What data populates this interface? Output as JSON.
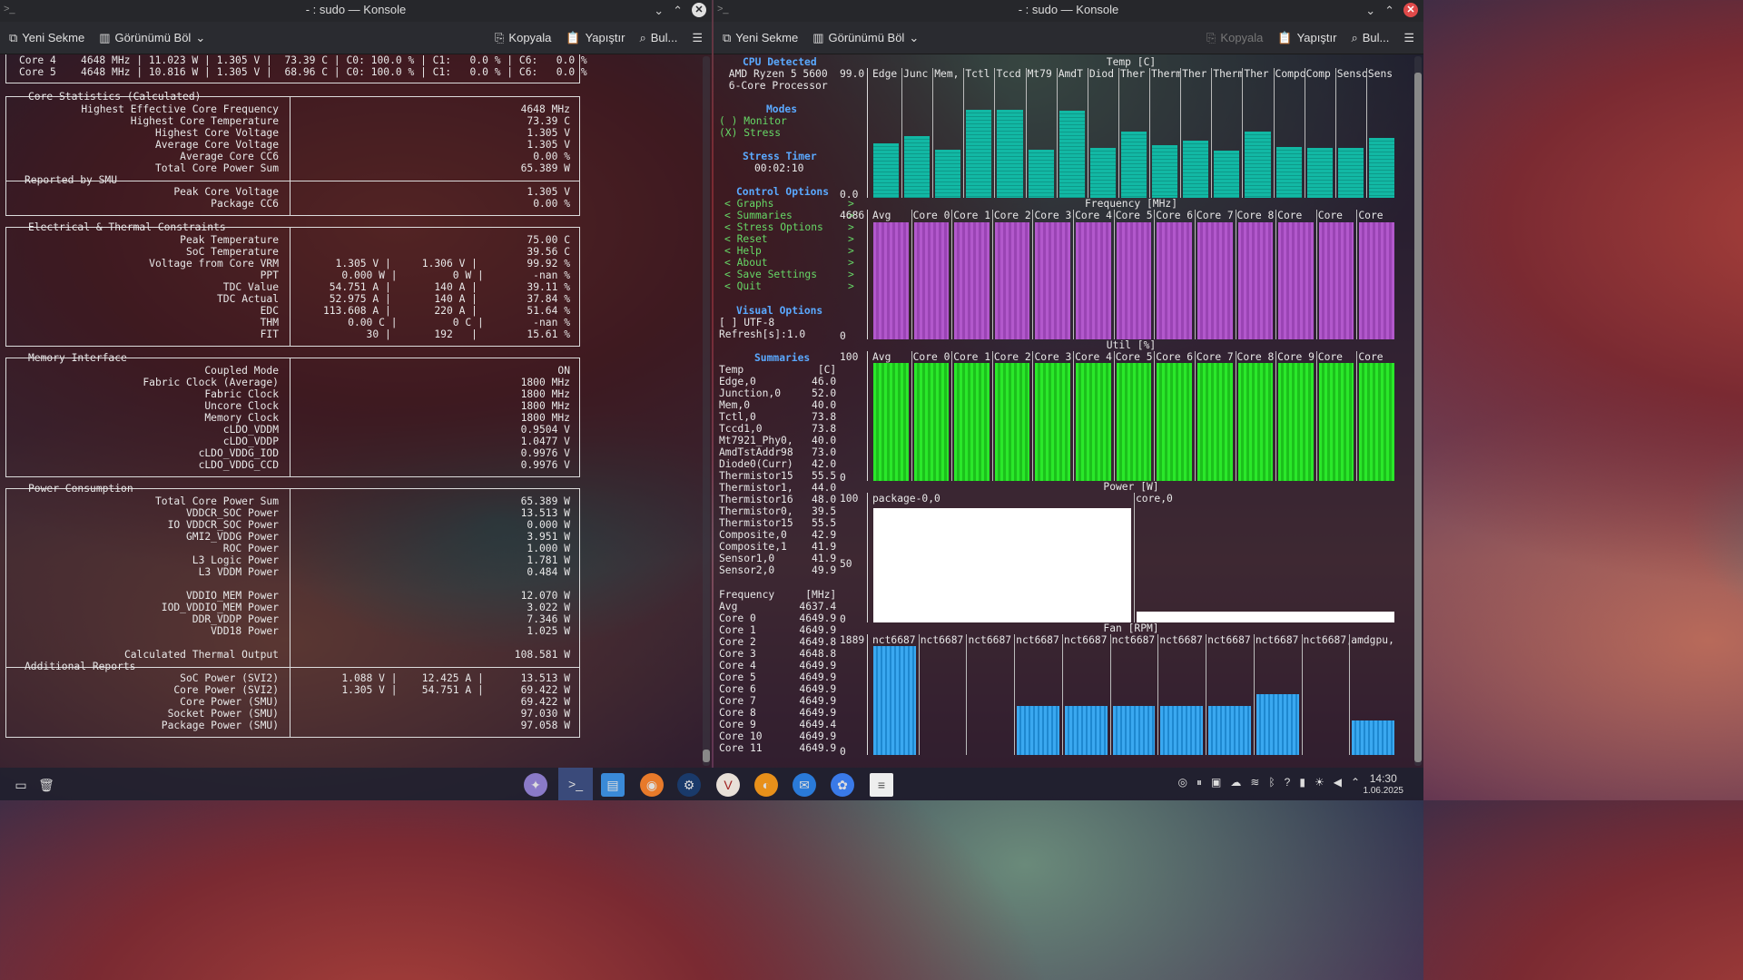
{
  "window_left": {
    "title": "- : sudo — Konsole",
    "toolbar": {
      "new_tab": "Yeni Sekme",
      "split": "Görünümü Böl",
      "copy": "Kopyala",
      "paste": "Yapıştır",
      "find": "Bul..."
    },
    "top_rows": [
      "Core 4    4648 MHz | 11.023 W | 1.305 V |  73.39 C | C0: 100.0 % | C1:   0.0 % | C6:   0.0 %",
      "Core 5    4648 MHz | 10.816 W | 1.305 V |  68.96 C | C0: 100.0 % | C1:   0.0 % | C6:   0.0 %"
    ],
    "sections": {
      "core_stats": {
        "title": "Core Statistics (Calculated)",
        "labels": "Highest Effective Core Frequency\nHighest Core Temperature\nHighest Core Voltage\nAverage Core Voltage\nAverage Core CC6\nTotal Core Power Sum",
        "values": "4648 MHz\n73.39 C\n1.305 V\n1.305 V\n0.00 %\n65.389 W"
      },
      "smu": {
        "title": "Reported by SMU",
        "labels": "Peak Core Voltage\nPackage CC6",
        "values": "1.305 V\n0.00 %"
      },
      "electrical": {
        "title": "Electrical & Thermal Constraints",
        "labels": "Peak Temperature\nSoC Temperature\nVoltage from Core VRM\nPPT\nTDC Value\nTDC Actual\nEDC\nTHM\nFIT",
        "values": "                                   75.00 C\n                                   39.56 C\n    1.305 V |     1.306 V |        99.92 %\n    0.000 W |         0 W |        -nan %\n   54.751 A |       140 A |        39.11 %\n   52.975 A |       140 A |        37.84 %\n  113.608 A |       220 A |        51.64 %\n     0.00 C |         0 C |        -nan %\n         30 |       192   |        15.61 %"
      },
      "memory": {
        "title": "Memory Interface",
        "labels": "Coupled Mode\nFabric Clock (Average)\nFabric Clock\nUncore Clock\nMemory Clock\ncLDO_VDDM\ncLDO_VDDP\ncLDO_VDDG_IOD\ncLDO_VDDG_CCD",
        "values": "ON\n1800 MHz\n1800 MHz\n1800 MHz\n1800 MHz\n0.9504 V\n1.0477 V\n0.9976 V\n0.9976 V"
      },
      "power": {
        "title": "Power Consumption",
        "labels": "Total Core Power Sum\nVDDCR_SOC Power\nIO VDDCR_SOC Power\nGMI2_VDDG Power\nROC Power\nL3 Logic Power\nL3 VDDM Power\n\nVDDIO_MEM Power\nIOD_VDDIO_MEM Power\nDDR_VDDP Power\nVDD18 Power\n\nCalculated Thermal Output",
        "values": "65.389 W\n13.513 W\n0.000 W\n3.951 W\n1.000 W\n1.781 W\n0.484 W\n\n12.070 W\n3.022 W\n7.346 W\n1.025 W\n\n108.581 W"
      },
      "additional": {
        "title": "Additional Reports",
        "labels": "SoC Power (SVI2)\nCore Power (SVI2)\nCore Power (SMU)\nSocket Power (SMU)\nPackage Power (SMU)",
        "values": "    1.088 V |    12.425 A |      13.513 W\n    1.305 V |    54.751 A |      69.422 W\n                                  69.422 W\n                                  97.030 W\n                                  97.058 W"
      }
    }
  },
  "window_right": {
    "title": "- : sudo — Konsole",
    "toolbar": {
      "new_tab": "Yeni Sekme",
      "split": "Görünümü Böl",
      "copy": "Kopyala",
      "paste": "Yapıştır",
      "find": "Bul..."
    },
    "cpu_detected": "CPU Detected",
    "cpu_name": " AMD Ryzen 5 5600\n 6-Core Processor",
    "modes_title": "Modes",
    "modes": "( ) Monitor\n(X) Stress",
    "stress_timer_title": "Stress Timer",
    "stress_timer": "00:02:10",
    "control_title": "Control Options",
    "controls": "< Graphs            >\n< Summaries         >\n< Stress Options    >\n< Reset             >\n< Help              >\n< About             >\n< Save Settings     >\n< Quit              >",
    "visual_title": "Visual Options",
    "visual": "[ ] UTF-8\nRefresh[s]:1.0",
    "summaries_title": "Summaries",
    "temp_summary": "Temp            [C]\nEdge,0         46.0\nJunction,0     52.0\nMem,0          40.0\nTctl,0         73.8\nTccd1,0        73.8\nMt7921_Phy0,   40.0\nAmdTstAddr98   73.0\nDiode0(Curr)   42.0\nThermistor15   55.5\nThermistor1,   44.0\nThermistor16   48.0\nThermistor0,   39.5\nThermistor15   55.5\nComposite,0    42.9\nComposite,1    41.9\nSensor1,0      41.9\nSensor2,0      49.9",
    "freq_summary": "Frequency     [MHz]\nAvg          4637.4\nCore 0       4649.9\nCore 1       4649.9\nCore 2       4649.8\nCore 3       4648.8\nCore 4       4649.9\nCore 5       4649.9\nCore 6       4649.9\nCore 7       4649.9\nCore 8       4649.9\nCore 9       4649.4\nCore 10      4649.9\nCore 11      4649.9",
    "graphs": {
      "temp": {
        "title": "Temp [C]",
        "ymax": "99.0",
        "ymin": "0.0",
        "labels": [
          "Edge",
          "Junc",
          "Mem,",
          "Tctl",
          "Tccd",
          "Mt79",
          "AmdT",
          "Diod",
          "Ther",
          "Therm",
          "Ther",
          "Therm",
          "Ther",
          "Compo",
          "Comp",
          "Senso",
          "Sens"
        ],
        "values": [
          46.0,
          52.0,
          40.0,
          73.8,
          73.8,
          40.0,
          73.0,
          42.0,
          55.5,
          44.0,
          48.0,
          39.5,
          55.5,
          42.9,
          41.9,
          41.9,
          49.9
        ],
        "color": "#10b0a0"
      },
      "freq": {
        "title": "Frequency [MHz]",
        "ymax": "4686",
        "ymin": "0",
        "labels": [
          "Avg",
          "Core 0",
          "Core 1",
          "Core 2",
          "Core 3",
          "Core 4",
          "Core 5",
          "Core 6",
          "Core 7",
          "Core 8",
          "Core",
          "Core",
          "Core"
        ],
        "values": [
          4637.4,
          4649.9,
          4649.9,
          4649.8,
          4648.8,
          4649.9,
          4649.9,
          4649.9,
          4649.9,
          4649.9,
          4649.4,
          4649.9,
          4649.9
        ],
        "color": "#a84fc0"
      },
      "util": {
        "title": "Util [%]",
        "ymax": "100",
        "ymin": "0",
        "labels": [
          "Avg",
          "Core 0",
          "Core 1",
          "Core 2",
          "Core 3",
          "Core 4",
          "Core 5",
          "Core 6",
          "Core 7",
          "Core 8",
          "Core 9",
          "Core",
          "Core"
        ],
        "values": [
          100,
          100,
          100,
          100,
          100,
          100,
          100,
          100,
          100,
          100,
          100,
          100,
          100
        ],
        "color": "#22dd22"
      },
      "power": {
        "title": "Power [W]",
        "ymax": "100",
        "ymid": "50",
        "ymin": "0",
        "labels": [
          "package-0,0",
          "core,0"
        ],
        "values": [
          97.058,
          4.0
        ],
        "color": "#ffffff"
      },
      "fan": {
        "title": "Fan [RPM]",
        "ymax": "1889",
        "ymin": "0",
        "labels": [
          "nct6687",
          "nct6687",
          "nct6687",
          "nct6687",
          "nct6687",
          "nct6687",
          "nct6687",
          "nct6687",
          "nct6687",
          "nct6687,",
          "amdgpu,"
        ],
        "values": [
          1889,
          0,
          0,
          850,
          850,
          850,
          850,
          850,
          1050,
          0,
          600
        ],
        "color": "#2a9ae8"
      }
    }
  },
  "taskbar": {
    "time": "14:30",
    "date": "1.06.2025"
  },
  "colors": {
    "accent_blue": "#5aa9ff",
    "green": "#66d866",
    "purple": "#a84fc0",
    "teal": "#10b0a0"
  }
}
